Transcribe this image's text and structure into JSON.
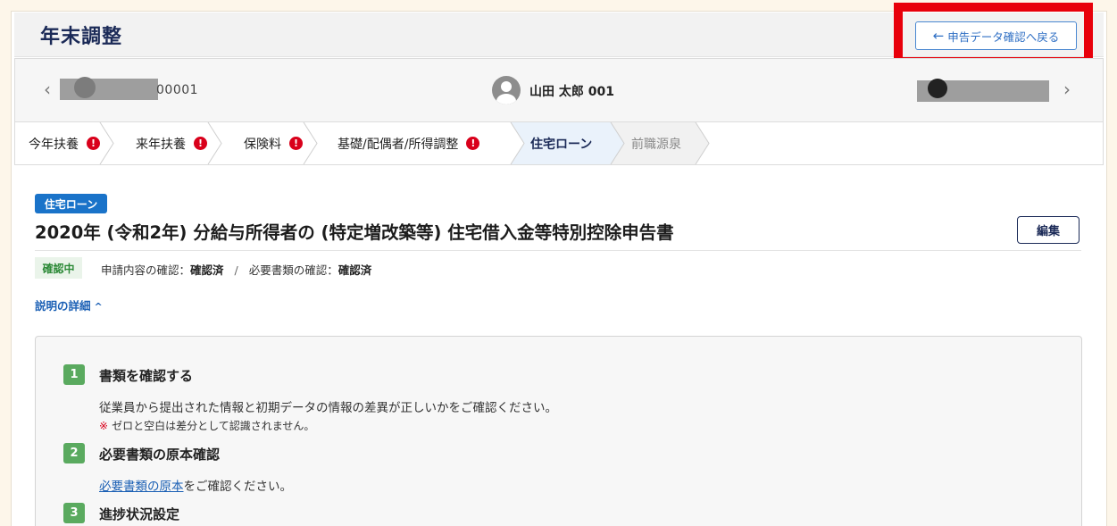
{
  "header": {
    "title": "年末調整",
    "back_button": "申告データ確認へ戻る"
  },
  "employee_nav": {
    "prev_code": "00001",
    "current_name": "山田 太郎 001"
  },
  "steps": [
    {
      "label": "今年扶養",
      "warning": true
    },
    {
      "label": "来年扶養",
      "warning": true
    },
    {
      "label": "保険料",
      "warning": true
    },
    {
      "label": "基礎/配偶者/所得調整",
      "warning": true
    },
    {
      "label": "住宅ローン",
      "active": true
    },
    {
      "label": "前職源泉",
      "disabled": true
    }
  ],
  "warn_glyph": "!",
  "content": {
    "badge": "住宅ローン",
    "title": "2020年 (令和2年) 分給与所得者の (特定増改築等) 住宅借入金等特別控除申告書",
    "edit_button": "編集",
    "status_badge": "確認中",
    "status_label1": "申請内容の確認：",
    "status_value1": "確認済",
    "status_sep": "/",
    "status_label2": "必要書類の確認：",
    "status_value2": "確認済",
    "detail_link": "説明の詳細",
    "detail_caret": "^"
  },
  "instructions": {
    "s1_num": "1",
    "s1_heading": "書類を確認する",
    "s1_text": "従業員から提出された情報と初期データの情報の差異が正しいかをご確認ください。",
    "s1_note_mark": "※",
    "s1_note": "ゼロと空白は差分として認識されません。",
    "s2_num": "2",
    "s2_heading": "必要書類の原本確認",
    "s2_link": "必要書類の原本",
    "s2_text": "をご確認ください。",
    "s3_num": "3",
    "s3_heading": "進捗状況設定"
  },
  "colors": {
    "accent_navy": "#1b2a57",
    "link_blue": "#1a5fb4",
    "badge_blue": "#1a73c9",
    "warning_red": "#d9001b",
    "highlight_red": "#e8000b",
    "step_green": "#5aaa5f"
  },
  "icons": {
    "back": "arrow-left-icon",
    "prev": "chevron-left-icon",
    "next": "chevron-right-icon",
    "user": "user-avatar-icon",
    "warning": "exclamation-circle-icon",
    "expand": "chevron-up-icon"
  }
}
